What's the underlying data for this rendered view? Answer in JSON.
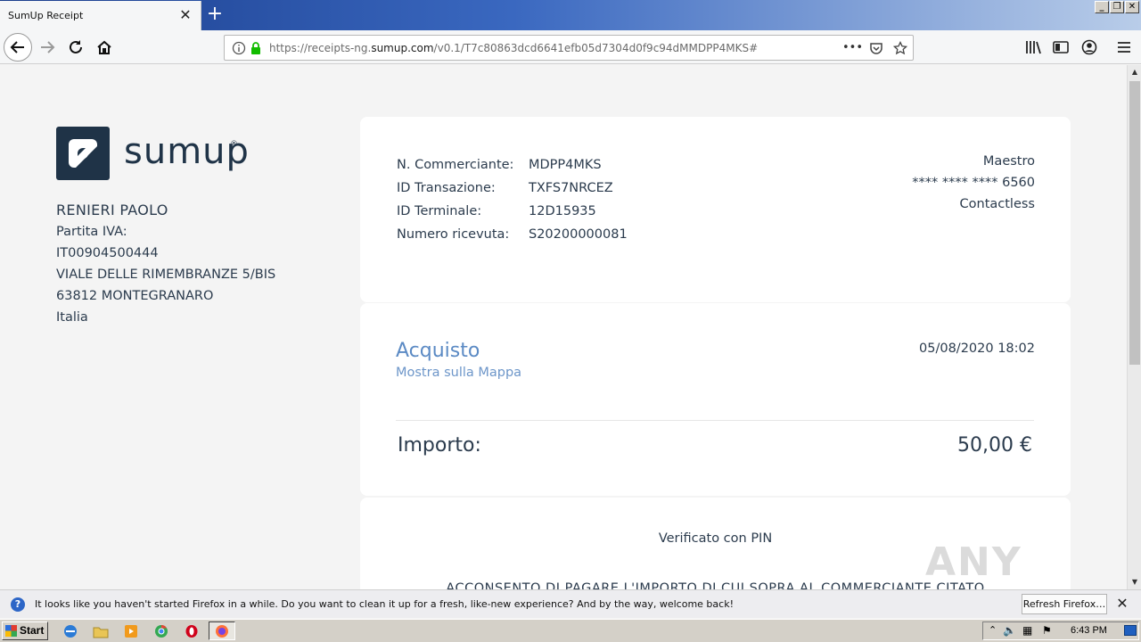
{
  "browser": {
    "tab_title": "SumUp Receipt",
    "url_prefix": "https://receipts-ng.",
    "url_domain": "sumup.com",
    "url_suffix": "/v0.1/T7c80863dcd6641efb05d7304d0f9c94dMMDPP4MKS#",
    "url_more": "•••"
  },
  "merchant": {
    "logo_text": "sumup",
    "logo_reg": "®",
    "name": "RENIERI PAOLO",
    "vat_label": "Partita IVA:",
    "vat_number": "IT00904500444",
    "address": "VIALE DELLE RIMEMBRANZE 5/BIS",
    "city": "63812 MONTEGRANARO",
    "country": "Italia"
  },
  "transaction": {
    "fields": [
      {
        "label": "N. Commerciante:",
        "value": "MDPP4MKS"
      },
      {
        "label": "ID Transazione:",
        "value": "TXFS7NRCEZ"
      },
      {
        "label": "ID Terminale:",
        "value": "12D15935"
      },
      {
        "label": "Numero ricevuta:",
        "value": "S20200000081"
      }
    ],
    "card_type": "Maestro",
    "card_number": "**** **** **** 6560",
    "entry_mode": "Contactless"
  },
  "purchase": {
    "title": "Acquisto",
    "map_link": "Mostra sulla Mappa",
    "datetime": "05/08/2020 18:02",
    "amount_label": "Importo:",
    "amount_value": "50,00 €"
  },
  "verification": {
    "pin_text": "Verificato con PIN",
    "consent_text": "ACCONSENTO DI PAGARE L'IMPORTO DI CUI SOPRA AL COMMERCIANTE CITATO"
  },
  "notification": {
    "text": "It looks like you haven't started Firefox in a while. Do you want to clean it up for a fresh, like-new experience? And by the way, welcome back!",
    "button": "Refresh Firefox…"
  },
  "taskbar": {
    "start_label": "Start",
    "clock": "6:43 PM"
  },
  "watermark": "ANY RUN"
}
